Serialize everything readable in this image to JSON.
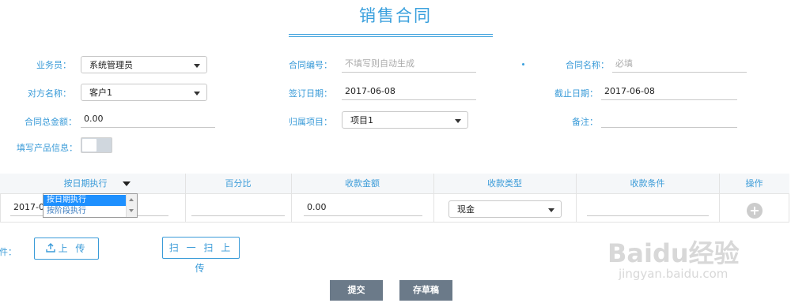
{
  "page": {
    "title": "销售合同"
  },
  "form": {
    "salesman": {
      "label": "业务员：",
      "value": "系统管理员"
    },
    "contract_no": {
      "label": "合同编号：",
      "placeholder": "不填写则自动生成"
    },
    "contract_name": {
      "label": "合同名称：",
      "placeholder": "必填"
    },
    "counterparty": {
      "label": "对方名称：",
      "value": "客户1"
    },
    "sign_date": {
      "label": "签订日期：",
      "value": "2017-06-08"
    },
    "end_date": {
      "label": "截止日期：",
      "value": "2017-06-08"
    },
    "total_amount": {
      "label": "合同总金额：",
      "value": "0.00"
    },
    "project": {
      "label": "归属项目：",
      "value": "项目1"
    },
    "remark": {
      "label": "备注：",
      "value": ""
    },
    "fill_product": {
      "label": "填写产品信息：",
      "on": false
    }
  },
  "table": {
    "headers": [
      "按日期执行",
      "百分比",
      "收款金额",
      "收款类型",
      "收款条件",
      "操作"
    ],
    "row": {
      "date": "2017-0",
      "percent": "",
      "amount": "0.00",
      "type": "现金",
      "condition": ""
    },
    "exec_dropdown": {
      "options": [
        "按日期执行",
        "按阶段执行"
      ],
      "selected": "按日期执行",
      "highlight": "#1e90ff"
    }
  },
  "attachment": {
    "label": "附件：",
    "upload_label": "上 传",
    "scan_label": "扫 一 扫 上 传"
  },
  "actions": {
    "submit": "提交",
    "draft": "存草稿"
  },
  "watermark": {
    "brand": "Baidu经验",
    "url": "jingyan.baidu.com"
  },
  "colors": {
    "accent": "#3aa0dd",
    "button": "#6b7a89"
  }
}
